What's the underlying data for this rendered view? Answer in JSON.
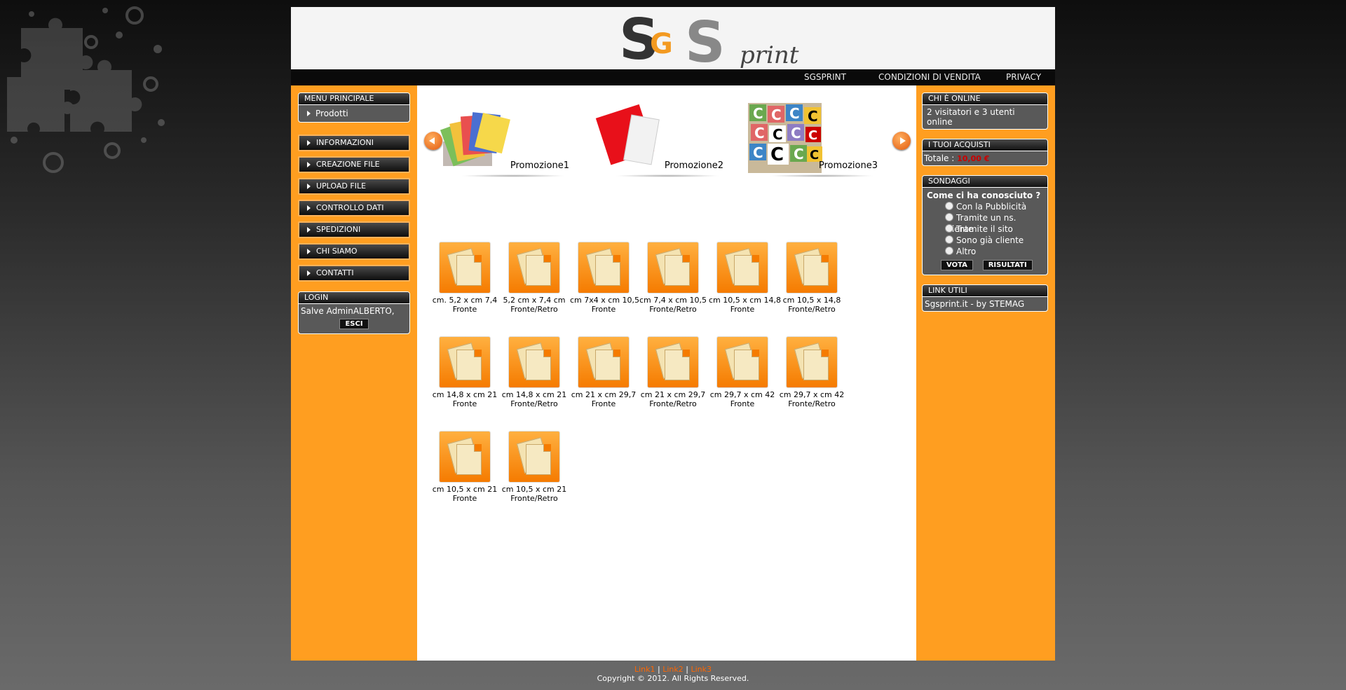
{
  "header": {
    "logo_text": "SGS",
    "logo_sub": "print"
  },
  "topnav": [
    "SGSPRINT",
    "CONDIZIONI DI VENDITA",
    "PRIVACY"
  ],
  "left": {
    "main_menu_title": "MENU PRINCIPALE",
    "main_menu_item": "Prodotti",
    "menu": [
      "INFORMAZIONI",
      "CREAZIONE FILE",
      "UPLOAD FILE",
      "CONTROLLO DATI",
      "SPEDIZIONI",
      "CHI SIAMO",
      "CONTATTI"
    ],
    "login_title": "LOGIN",
    "login_greeting": "Salve AdminALBERTO,",
    "logout_label": "ESCI"
  },
  "promos": [
    "Promozione1",
    "Promozione2",
    "Promozione3"
  ],
  "products": [
    {
      "line1": "cm. 5,2 x cm 7,4",
      "line2": "Fronte"
    },
    {
      "line1": "5,2 cm x 7,4 cm",
      "line2": "Fronte/Retro"
    },
    {
      "line1": "cm 7x4 x cm 10,5",
      "line2": "Fronte"
    },
    {
      "line1": "cm 7,4 x cm 10,5",
      "line2": "Fronte/Retro"
    },
    {
      "line1": "cm 10,5 x cm 14,8",
      "line2": "Fronte"
    },
    {
      "line1": "cm 10,5 x 14,8",
      "line2": "Fronte/Retro"
    },
    {
      "line1": "cm 14,8 x cm 21",
      "line2": "Fronte"
    },
    {
      "line1": "cm 14,8 x cm 21",
      "line2": "Fronte/Retro"
    },
    {
      "line1": "cm 21 x cm 29,7",
      "line2": "Fronte"
    },
    {
      "line1": "cm 21 x cm 29,7",
      "line2": "Fronte/Retro"
    },
    {
      "line1": "cm 29,7 x cm 42",
      "line2": "Fronte"
    },
    {
      "line1": "cm 29,7 x cm 42",
      "line2": "Fronte/Retro"
    },
    {
      "line1": "cm 10,5 x cm 21",
      "line2": "Fronte"
    },
    {
      "line1": "cm 10,5 x cm 21",
      "line2": "Fronte/Retro"
    }
  ],
  "right": {
    "online_title": "CHI È ONLINE",
    "online_text": "2 visitatori e 3 utenti online",
    "purchases_title": "I TUOI ACQUISTI",
    "total_label": "Totale :",
    "total_value": "10,00 €",
    "poll_title": "SONDAGGI",
    "poll_question": "Come ci ha conosciuto ?",
    "poll_options": [
      "Con la Pubblicità",
      "Tramite un ns. cliente",
      "Tramite il sito",
      "Sono già cliente",
      "Altro"
    ],
    "vote_label": "VOTA",
    "results_label": "RISULTATI",
    "links_title": "LINK UTILI",
    "links_text": "Sgsprint.it - by STEMAG"
  },
  "footer": {
    "links": [
      "Link1",
      "Link2",
      "Link3"
    ],
    "copyright": "Copyright © 2012. All Rights Reserved."
  },
  "colors": {
    "orange": "#ff9e20",
    "dark": "#0a0a0a",
    "total_red": "#cc0000"
  }
}
